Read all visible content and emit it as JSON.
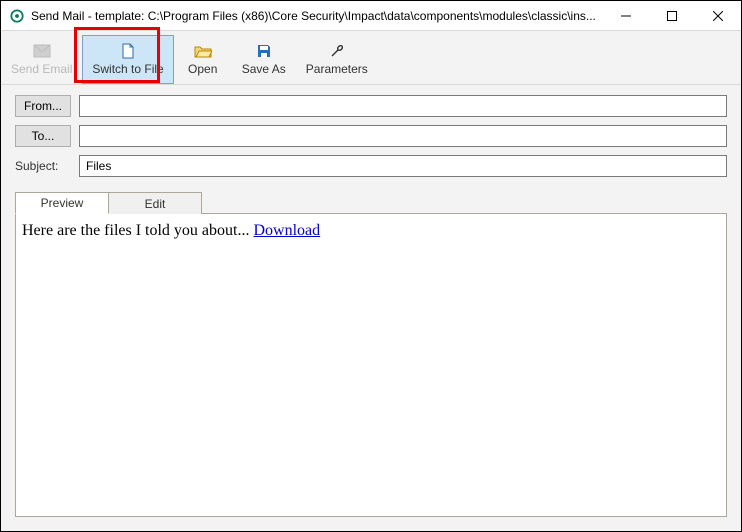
{
  "window": {
    "title": "Send Mail - template: C:\\Program Files (x86)\\Core Security\\Impact\\data\\components\\modules\\classic\\ins..."
  },
  "toolbar": {
    "send_email": "Send Email",
    "switch_to_file": "Switch to File",
    "open": "Open",
    "save_as": "Save As",
    "parameters": "Parameters"
  },
  "form": {
    "from_label": "From...",
    "to_label": "To...",
    "subject_label": "Subject:",
    "from_value": "",
    "to_value": "",
    "subject_value": "Files"
  },
  "tabs": {
    "preview": "Preview",
    "edit": "Edit"
  },
  "body": {
    "text_prefix": "Here are the files I told you about... ",
    "link_text": "Download"
  }
}
